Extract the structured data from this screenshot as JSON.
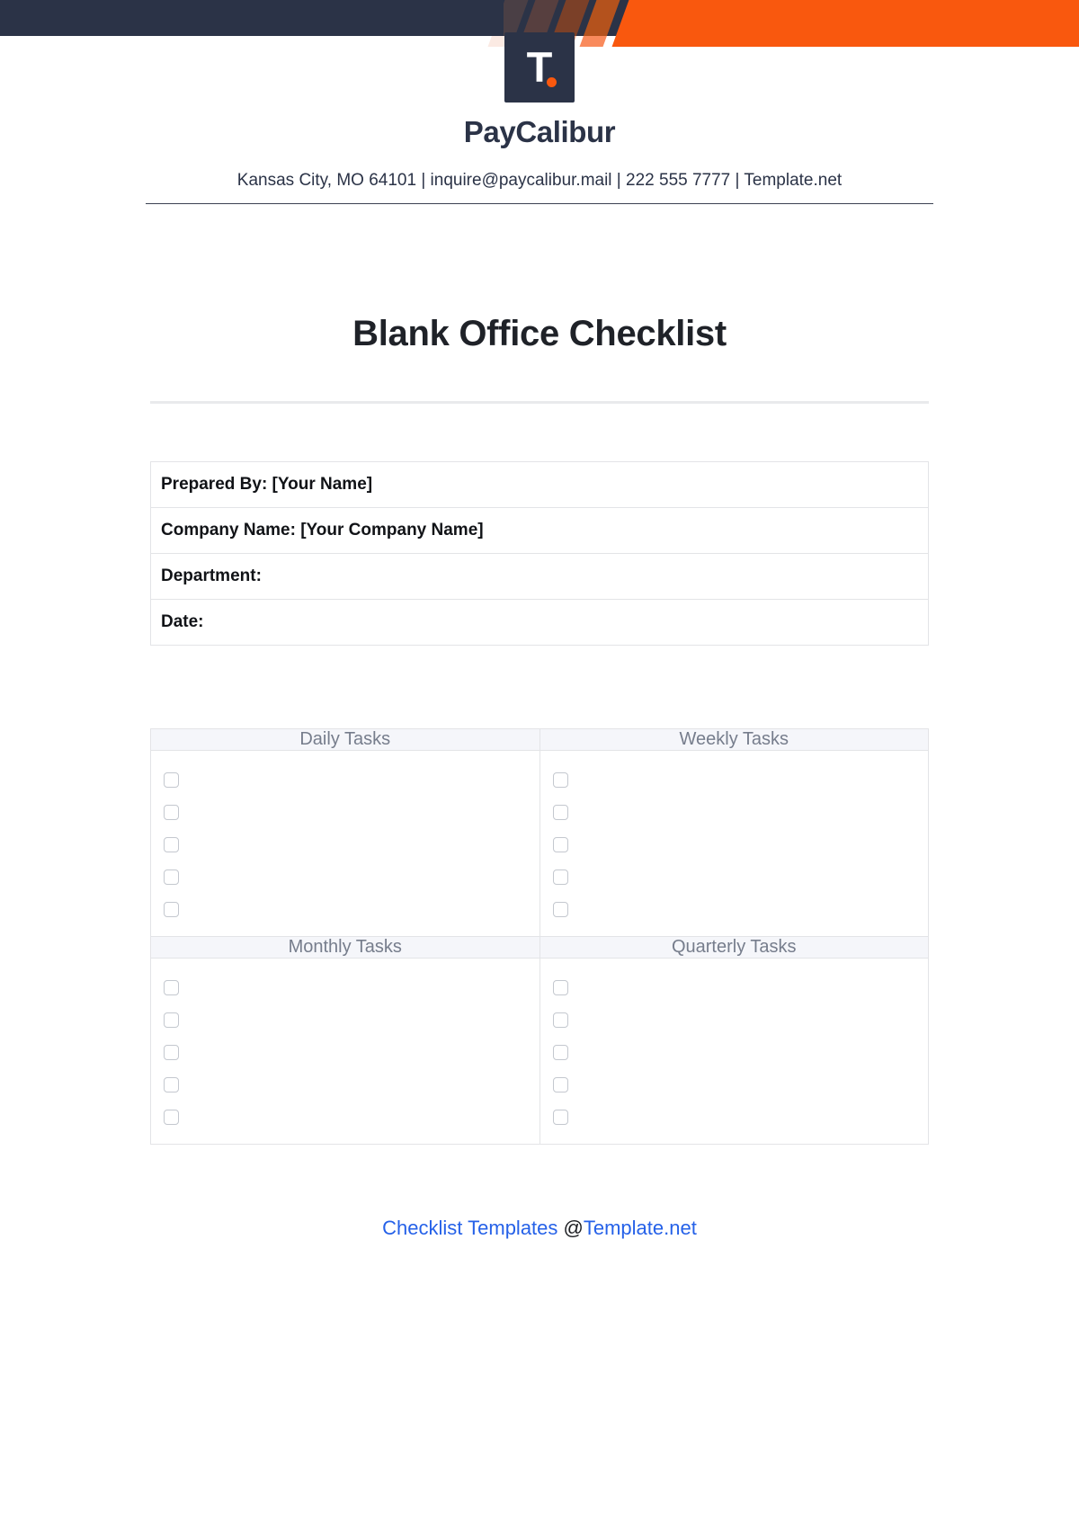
{
  "topbar": {
    "navy_color": "#2b3347",
    "accent_color": "#f9580e",
    "stripe_colors": [
      "#fbeae3",
      "#f9d6c6",
      "#f8b193",
      "#f98a5c",
      "#f9580e"
    ]
  },
  "brand": {
    "logo_letter": "T",
    "logo_dot": "•",
    "name": "PayCalibur",
    "contact": "Kansas City, MO 64101 | inquire@paycalibur.mail | 222 555 7777 | Template.net"
  },
  "document": {
    "title": "Blank Office Checklist"
  },
  "info_rows": [
    "Prepared By: [Your Name]",
    "Company Name: [Your Company Name]",
    "Department:",
    "Date:"
  ],
  "checklist": {
    "sections": [
      {
        "title": "Daily Tasks",
        "items": [
          "",
          "",
          "",
          "",
          ""
        ]
      },
      {
        "title": "Weekly Tasks",
        "items": [
          "",
          "",
          "",
          "",
          ""
        ]
      },
      {
        "title": "Monthly Tasks",
        "items": [
          "",
          "",
          "",
          "",
          ""
        ]
      },
      {
        "title": "Quarterly Tasks",
        "items": [
          "",
          "",
          "",
          "",
          ""
        ]
      }
    ]
  },
  "footer": {
    "link_part1": "Checklist Templates ",
    "at": "@",
    "link_part2": "Template.net"
  }
}
